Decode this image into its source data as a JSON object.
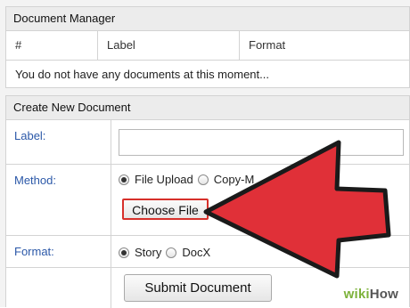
{
  "document_manager": {
    "title": "Document Manager",
    "columns": [
      "#",
      "Label",
      "Format"
    ],
    "empty_message": "You do not have any documents at this moment..."
  },
  "create_document": {
    "title": "Create New Document",
    "label_field": {
      "label": "Label:",
      "value": ""
    },
    "method": {
      "label": "Method:",
      "options": [
        "File Upload",
        "Copy-M"
      ],
      "selected": "File Upload",
      "choose_file_label": "Choose File"
    },
    "format": {
      "label": "Format:",
      "options": [
        "Story",
        "DocX"
      ],
      "selected": "Story"
    },
    "submit_label": "Submit Document"
  },
  "watermark": {
    "part1": "wiki",
    "part2": "How"
  },
  "colors": {
    "arrow_fill": "#e03038",
    "arrow_outline": "#1a1a1a",
    "label_color": "#2b58a8",
    "highlight_border": "#d7302b"
  }
}
